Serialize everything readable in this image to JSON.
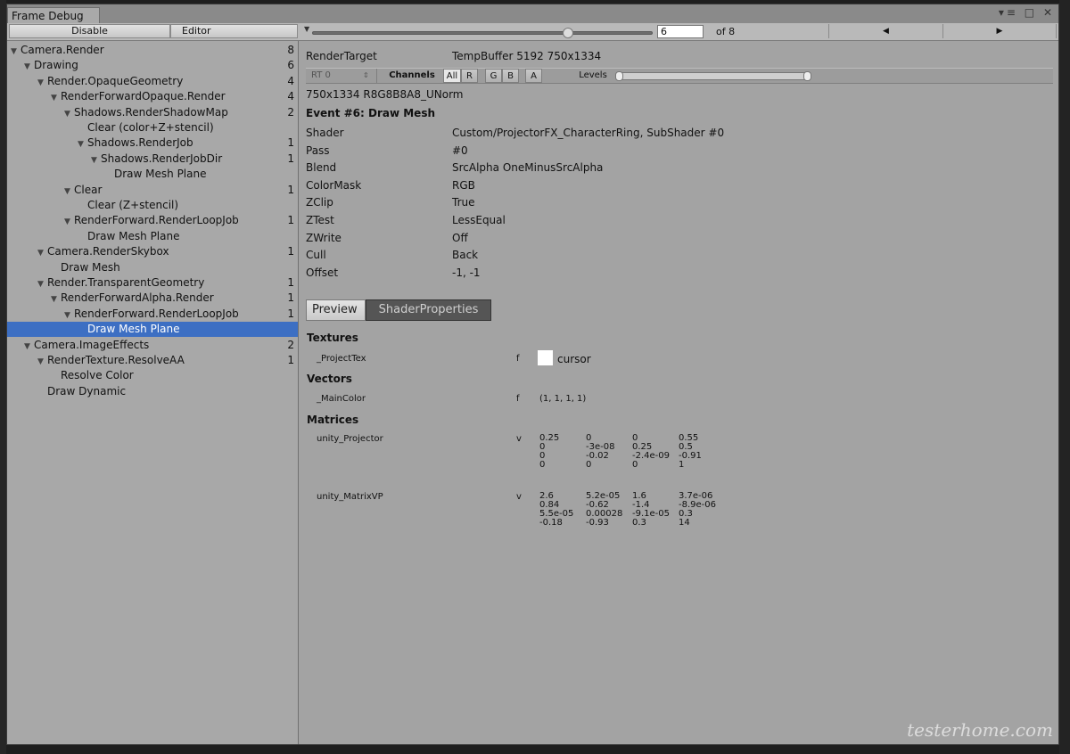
{
  "window": {
    "tab_title": "Frame Debug",
    "controls": [
      "▾≡",
      "□",
      "✕"
    ]
  },
  "toolbar": {
    "disable_label": "Disable",
    "editor_label": "Editor",
    "frame_value": "6",
    "frame_total": "of 8",
    "slider_fraction": 0.75,
    "prev_icon": "◀",
    "next_icon": "▶"
  },
  "tree": {
    "items": [
      {
        "label": "Camera.Render",
        "count": "8",
        "depth": 0,
        "expanded": true
      },
      {
        "label": "Drawing",
        "count": "6",
        "depth": 1,
        "expanded": true
      },
      {
        "label": "Render.OpaqueGeometry",
        "count": "4",
        "depth": 2,
        "expanded": true
      },
      {
        "label": "RenderForwardOpaque.Render",
        "count": "4",
        "depth": 3,
        "expanded": true
      },
      {
        "label": "Shadows.RenderShadowMap",
        "count": "2",
        "depth": 4,
        "expanded": true
      },
      {
        "label": "Clear (color+Z+stencil)",
        "count": "",
        "depth": 5,
        "expanded": null
      },
      {
        "label": "Shadows.RenderJob",
        "count": "1",
        "depth": 5,
        "expanded": true
      },
      {
        "label": "Shadows.RenderJobDir",
        "count": "1",
        "depth": 6,
        "expanded": true
      },
      {
        "label": "Draw Mesh Plane",
        "count": "",
        "depth": 7,
        "expanded": null
      },
      {
        "label": "Clear",
        "count": "1",
        "depth": 4,
        "expanded": true
      },
      {
        "label": "Clear (Z+stencil)",
        "count": "",
        "depth": 5,
        "expanded": null
      },
      {
        "label": "RenderForward.RenderLoopJob",
        "count": "1",
        "depth": 4,
        "expanded": true
      },
      {
        "label": "Draw Mesh Plane",
        "count": "",
        "depth": 5,
        "expanded": null
      },
      {
        "label": "Camera.RenderSkybox",
        "count": "1",
        "depth": 2,
        "expanded": true
      },
      {
        "label": "Draw Mesh",
        "count": "",
        "depth": 3,
        "expanded": null
      },
      {
        "label": "Render.TransparentGeometry",
        "count": "1",
        "depth": 2,
        "expanded": true
      },
      {
        "label": "RenderForwardAlpha.Render",
        "count": "1",
        "depth": 3,
        "expanded": true
      },
      {
        "label": "RenderForward.RenderLoopJob",
        "count": "1",
        "depth": 4,
        "expanded": true
      },
      {
        "label": "Draw Mesh Plane",
        "count": "",
        "depth": 5,
        "expanded": null,
        "selected": true
      },
      {
        "label": "Camera.ImageEffects",
        "count": "2",
        "depth": 1,
        "expanded": true
      },
      {
        "label": "RenderTexture.ResolveAA",
        "count": "1",
        "depth": 2,
        "expanded": true
      },
      {
        "label": "Resolve Color",
        "count": "",
        "depth": 3,
        "expanded": null
      },
      {
        "label": "Draw Dynamic",
        "count": "",
        "depth": 2,
        "expanded": null
      }
    ]
  },
  "details": {
    "render_target_key": "RenderTarget",
    "render_target_val": "TempBuffer 5192 750x1334",
    "rt_select": "RT 0",
    "channels_label": "Channels",
    "channels": [
      "All",
      "R",
      "G",
      "B",
      "A"
    ],
    "levels_label": "Levels",
    "format_line": "750x1334 R8G8B8A8_UNorm",
    "event_title": "Event #6: Draw Mesh",
    "props": [
      {
        "key": "Shader",
        "val": "Custom/ProjectorFX_CharacterRing, SubShader #0"
      },
      {
        "key": "Pass",
        "val": "#0"
      },
      {
        "key": "Blend",
        "val": "SrcAlpha OneMinusSrcAlpha"
      },
      {
        "key": "ColorMask",
        "val": "RGB"
      },
      {
        "key": "ZClip",
        "val": "True"
      },
      {
        "key": "ZTest",
        "val": "LessEqual"
      },
      {
        "key": "ZWrite",
        "val": "Off"
      },
      {
        "key": "Cull",
        "val": "Back"
      },
      {
        "key": "Offset",
        "val": "-1, -1"
      }
    ],
    "tabs": {
      "preview": "Preview",
      "shader_props": "ShaderProperties"
    },
    "textures_title": "Textures",
    "texture": {
      "name": "_ProjectTex",
      "type": "f",
      "value": "cursor"
    },
    "vectors_title": "Vectors",
    "vector": {
      "name": "_MainColor",
      "type": "f",
      "value": "(1, 1, 1, 1)"
    },
    "matrices_title": "Matrices",
    "matrices": [
      {
        "name": "unity_Projector",
        "type": "v",
        "rows": [
          [
            "0.25",
            "0",
            "0",
            "0.55"
          ],
          [
            "0",
            "-3e-08",
            "0.25",
            "0.5"
          ],
          [
            "0",
            "-0.02",
            "-2.4e-09",
            "-0.91"
          ],
          [
            "0",
            "0",
            "0",
            "1"
          ]
        ]
      },
      {
        "name": "unity_MatrixVP",
        "type": "v",
        "rows": [
          [
            "2.6",
            "5.2e-05",
            "1.6",
            "3.7e-06"
          ],
          [
            "0.84",
            "-0.62",
            "-1.4",
            "-8.9e-06"
          ],
          [
            "5.5e-05",
            "0.00028",
            "-9.1e-05",
            "0.3"
          ],
          [
            "-0.18",
            "-0.93",
            "0.3",
            "14"
          ]
        ]
      }
    ]
  },
  "watermark": "testerhome.com"
}
